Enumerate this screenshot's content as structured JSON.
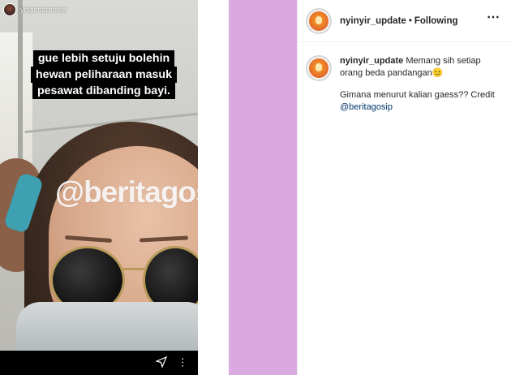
{
  "story": {
    "username": "yolandarmarie",
    "caption_lines": [
      "gue lebih setuju bolehin",
      "hewan peliharaan masuk",
      "pesawat dibanding bayi."
    ],
    "watermark": "@beritagosip",
    "send_icon": "send-icon",
    "more_icon": "more-dots-icon"
  },
  "post": {
    "username": "nyinyir_update",
    "separator": "•",
    "follow_status": "Following",
    "options_icon": "⋯",
    "caption": {
      "username": "nyinyir_update",
      "text": "Memang sih setiap orang beda pandangan😐",
      "line2_prefix": "Gimana menurut kalian gaess?? Credit",
      "mention": "@beritagosip"
    }
  },
  "colors": {
    "purple_strip": "#d9a9e0",
    "text": "#262626",
    "mention": "#00376b",
    "caption_bg": "#000000"
  }
}
